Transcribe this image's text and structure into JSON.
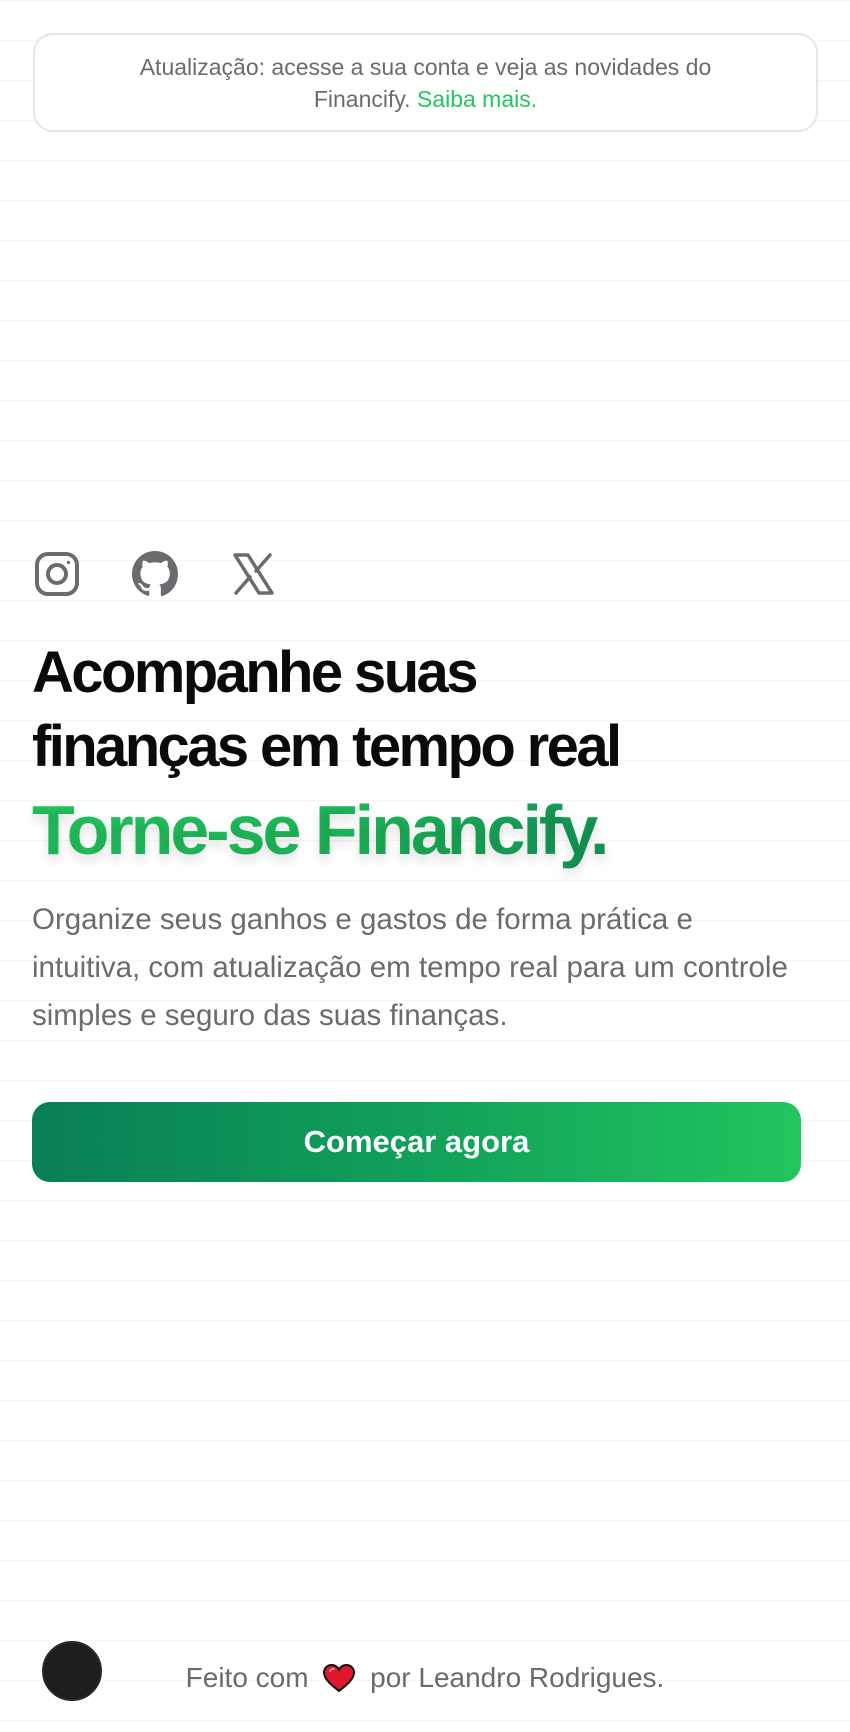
{
  "banner": {
    "text": "Atualização: acesse a sua conta e veja as novidades do Financify.",
    "link": "Saiba mais."
  },
  "socials": [
    {
      "icon": "instagram-icon"
    },
    {
      "icon": "github-icon"
    },
    {
      "icon": "x-icon"
    }
  ],
  "hero": {
    "title_line1": "Acompanhe suas",
    "title_line2": "finanças em tempo real",
    "highlight": "Torne-se Financify.",
    "description": "Organize seus ganhos e gastos de forma prática e intuitiva, com atualização em tempo real para um controle simples e seguro das suas finanças.",
    "cta_label": "Começar agora"
  },
  "footer": {
    "prefix": "Feito com",
    "heart_icon": "heart-icon",
    "suffix": "por Leandro Rodrigues."
  },
  "colors": {
    "accent": "#22c55e",
    "accent_dark": "#087f55",
    "text_muted": "#6b6b6f",
    "heading": "#0a0a0a"
  }
}
